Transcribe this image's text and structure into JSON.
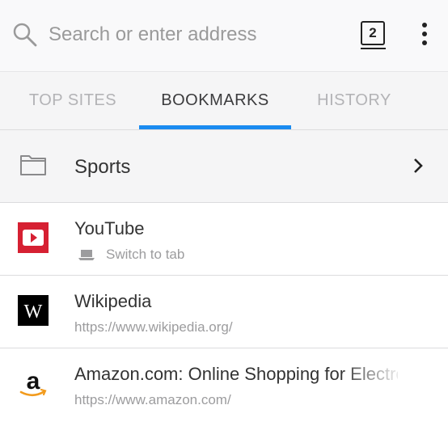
{
  "toolbar": {
    "search_placeholder": "Search or enter address",
    "tab_count": "2"
  },
  "tabs": [
    {
      "label": "TOP SITES",
      "active": false
    },
    {
      "label": "BOOKMARKS",
      "active": true
    },
    {
      "label": "HISTORY",
      "active": false
    }
  ],
  "folder": {
    "label": "Sports"
  },
  "bookmarks": [
    {
      "title": "YouTube",
      "subtitle": "Switch to tab",
      "icon": "youtube-icon"
    },
    {
      "title": "Wikipedia",
      "subtitle": "https://www.wikipedia.org/",
      "icon": "wikipedia-icon"
    },
    {
      "title": "Amazon.com: Online Shopping for Electronics",
      "subtitle": "https://www.amazon.com/",
      "icon": "amazon-icon"
    }
  ],
  "colors": {
    "accent": "#1a8bf0",
    "youtube_red": "#d62032"
  }
}
